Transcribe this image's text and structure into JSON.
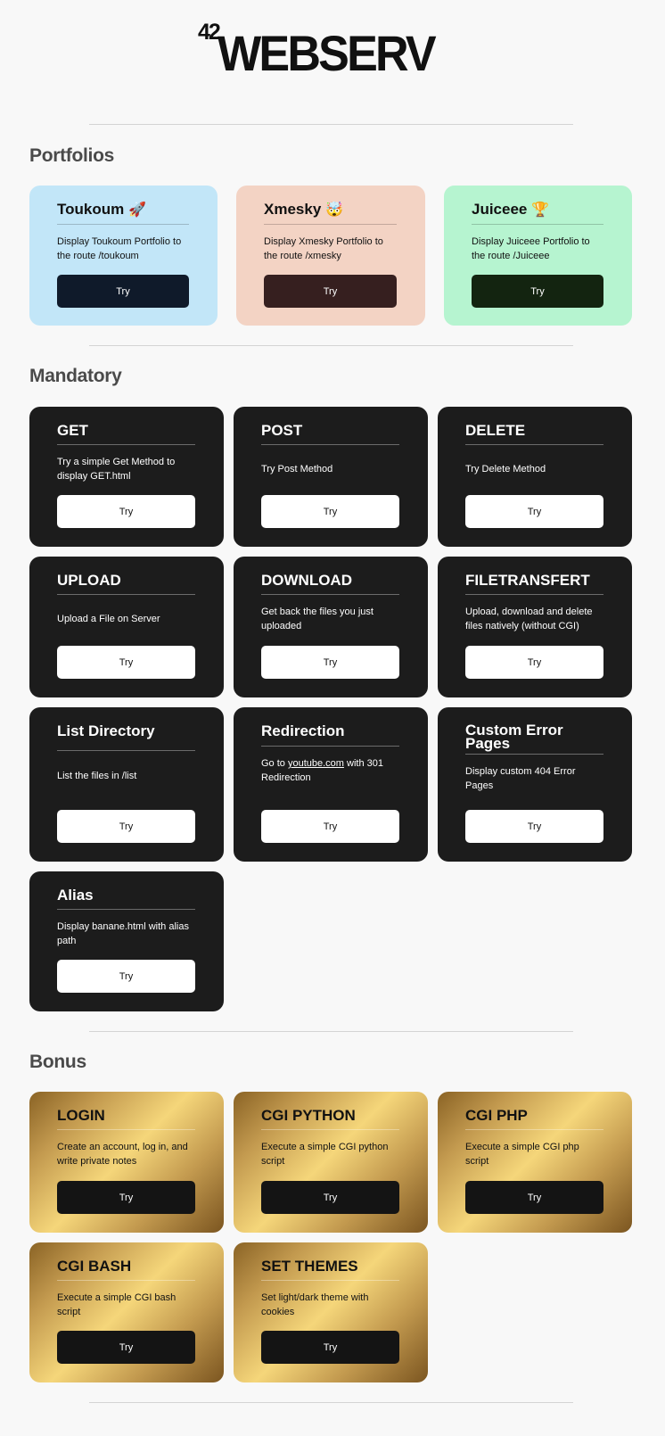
{
  "header": {
    "logo_42": "42",
    "logo_text": "WEBSERV"
  },
  "sections": {
    "portfolios": "Portfolios",
    "mandatory": "Mandatory",
    "bonus": "Bonus"
  },
  "portfolios": [
    {
      "title": "Toukoum",
      "emoji": "🚀",
      "desc": "Display Toukoum Portfolio to the route /toukoum",
      "button": "Try",
      "bg": "#c2e6f8",
      "btn_bg": "#0f1a2a"
    },
    {
      "title": "Xmesky",
      "emoji": "🤯",
      "desc": "Display Xmesky Portfolio to the route /xmesky",
      "button": "Try",
      "bg": "#f3d3c4",
      "btn_bg": "#361f1f"
    },
    {
      "title": "Juiceee",
      "emoji": "🏆",
      "desc": "Display Juiceee Portfolio to the route /Juiceee",
      "button": "Try",
      "bg": "#b6f4d0",
      "btn_bg": "#132410"
    }
  ],
  "mandatory": [
    {
      "title": "GET",
      "desc": "Try a simple Get Method to display GET.html",
      "button": "Try"
    },
    {
      "title": "POST",
      "desc": "Try Post Method",
      "button": "Try"
    },
    {
      "title": "DELETE",
      "desc": "Try Delete Method",
      "button": "Try"
    },
    {
      "title": "UPLOAD",
      "desc": "Upload a File on Server",
      "button": "Try"
    },
    {
      "title": "DOWNLOAD",
      "desc": "Get back the files you just uploaded",
      "button": "Try"
    },
    {
      "title": "FILETRANSFERT",
      "desc": "Upload, download and delete files natively (without CGI)",
      "button": "Try"
    },
    {
      "title": "List Directory",
      "desc": "List the files in /list",
      "button": "Try"
    },
    {
      "title": "Redirection",
      "desc_pre": "Go to ",
      "desc_link": "youtube.com",
      "desc_post": " with 301 Redirection",
      "button": "Try"
    },
    {
      "title": "Custom Error Pages",
      "desc": "Display custom 404 Error Pages",
      "button": "Try"
    },
    {
      "title": "Alias",
      "desc": "Display banane.html with alias path",
      "button": "Try"
    }
  ],
  "bonus": [
    {
      "title": "LOGIN",
      "desc": "Create an account, log in, and write private notes",
      "button": "Try"
    },
    {
      "title": "CGI PYTHON",
      "desc": "Execute a simple CGI python script",
      "button": "Try"
    },
    {
      "title": "CGI PHP",
      "desc": "Execute a simple CGI php script",
      "button": "Try"
    },
    {
      "title": "CGI BASH",
      "desc": "Execute a simple CGI bash script",
      "button": "Try"
    },
    {
      "title": "SET THEMES",
      "desc": "Set light/dark theme with cookies",
      "button": "Try"
    }
  ]
}
